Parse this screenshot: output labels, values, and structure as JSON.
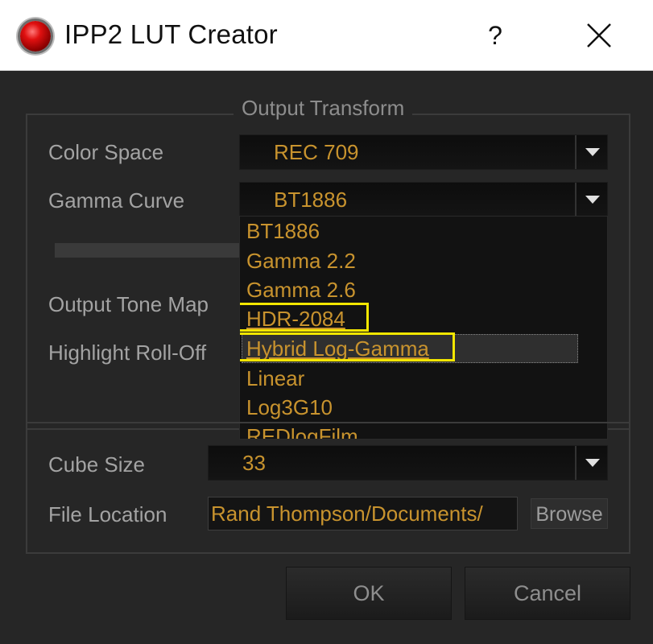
{
  "window": {
    "title": "IPP2 LUT Creator",
    "help_label": "?",
    "icons": {
      "app": "red-record-icon",
      "close": "close-icon"
    }
  },
  "output_transform": {
    "legend": "Output Transform",
    "color_space": {
      "label": "Color Space",
      "value": "REC 709"
    },
    "gamma_curve": {
      "label": "Gamma Curve",
      "value": "BT1886",
      "options": [
        "BT1886",
        "Gamma 2.2",
        "Gamma 2.6",
        "HDR-2084",
        "Hybrid Log-Gamma",
        "Linear",
        "Log3G10",
        "REDlogFilm"
      ],
      "highlighted_option": "Hybrid Log-Gamma"
    },
    "output_tone_map": {
      "label": "Output Tone Map"
    },
    "highlight_roll_off": {
      "label": "Highlight Roll-Off"
    }
  },
  "cube": {
    "cube_size": {
      "label": "Cube Size",
      "value": "33"
    },
    "file_location": {
      "label": "File Location",
      "value": "Rand Thompson/Documents/",
      "browse_label": "Browse"
    }
  },
  "buttons": {
    "ok": "OK",
    "cancel": "Cancel"
  },
  "colors": {
    "accent_text": "#c8932e",
    "highlight_box": "#f2e600",
    "background": "#262626"
  }
}
